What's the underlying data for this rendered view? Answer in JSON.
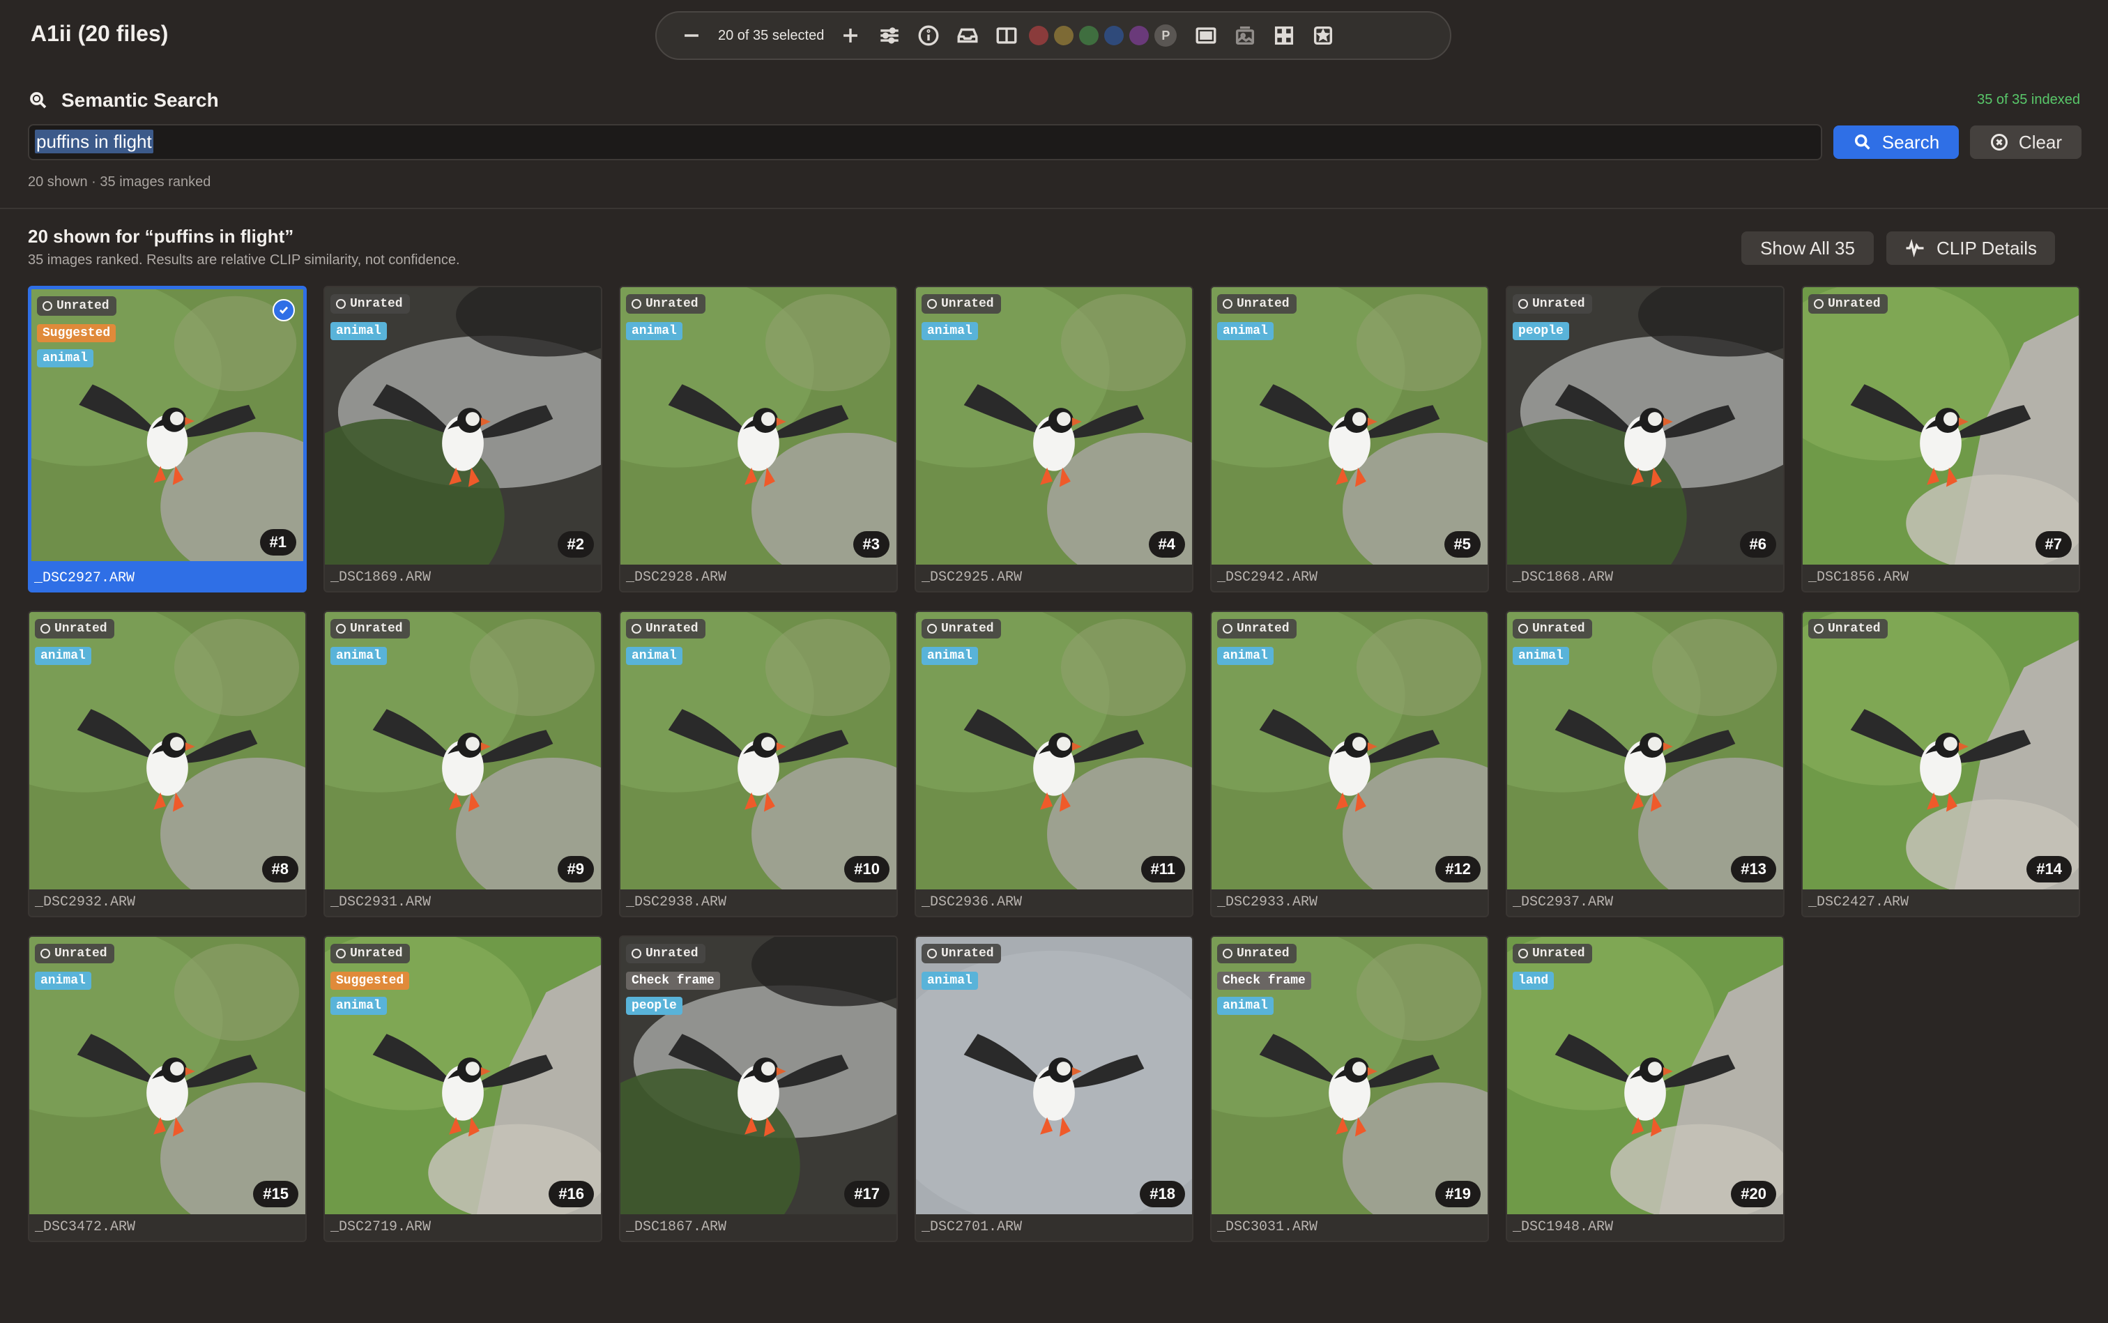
{
  "app": {
    "title": "A1ii (20 files)"
  },
  "toolbar": {
    "selection_count": "20 of 35 selected",
    "color_labels": [
      "#8a3b3b",
      "#7d6a35",
      "#3f6e3f",
      "#2f4a7a",
      "#6a3a7a"
    ],
    "p_label": "P",
    "icons": [
      "minus-icon",
      "plus-icon",
      "sliders-icon",
      "info-icon",
      "tray-icon",
      "split-view-icon",
      "fullscreen-icon",
      "photos-icon",
      "grid-icon",
      "star-icon"
    ]
  },
  "search": {
    "heading": "Semantic Search",
    "indexed": "35 of 35 indexed",
    "query": "puffins in flight",
    "search_label": "Search",
    "clear_label": "Clear",
    "ranked_line": "20 shown · 35 images ranked"
  },
  "results": {
    "title": "20 shown for “puffins in flight”",
    "subtitle": "35 images ranked. Results are relative CLIP similarity, not confidence.",
    "show_all_label": "Show All 35",
    "clip_label": "CLIP Details"
  },
  "items": [
    {
      "file": "_DSC2927.ARW",
      "rank": "#1",
      "rating": "Unrated",
      "tags": [
        "Suggested",
        "animal"
      ],
      "selected": true,
      "scene": "grass"
    },
    {
      "file": "_DSC1869.ARW",
      "rank": "#2",
      "rating": "Unrated",
      "tags": [
        "animal"
      ],
      "selected": false,
      "scene": "water"
    },
    {
      "file": "_DSC2928.ARW",
      "rank": "#3",
      "rating": "Unrated",
      "tags": [
        "animal"
      ],
      "selected": false,
      "scene": "grass"
    },
    {
      "file": "_DSC2925.ARW",
      "rank": "#4",
      "rating": "Unrated",
      "tags": [
        "animal"
      ],
      "selected": false,
      "scene": "grass"
    },
    {
      "file": "_DSC2942.ARW",
      "rank": "#5",
      "rating": "Unrated",
      "tags": [
        "animal"
      ],
      "selected": false,
      "scene": "grass"
    },
    {
      "file": "_DSC1868.ARW",
      "rank": "#6",
      "rating": "Unrated",
      "tags": [
        "people"
      ],
      "selected": false,
      "scene": "water"
    },
    {
      "file": "_DSC1856.ARW",
      "rank": "#7",
      "rating": "Unrated",
      "tags": [],
      "selected": false,
      "scene": "rock"
    },
    {
      "file": "_DSC2932.ARW",
      "rank": "#8",
      "rating": "Unrated",
      "tags": [
        "animal"
      ],
      "selected": false,
      "scene": "grass"
    },
    {
      "file": "_DSC2931.ARW",
      "rank": "#9",
      "rating": "Unrated",
      "tags": [
        "animal"
      ],
      "selected": false,
      "scene": "grass"
    },
    {
      "file": "_DSC2938.ARW",
      "rank": "#10",
      "rating": "Unrated",
      "tags": [
        "animal"
      ],
      "selected": false,
      "scene": "grass"
    },
    {
      "file": "_DSC2936.ARW",
      "rank": "#11",
      "rating": "Unrated",
      "tags": [
        "animal"
      ],
      "selected": false,
      "scene": "grass"
    },
    {
      "file": "_DSC2933.ARW",
      "rank": "#12",
      "rating": "Unrated",
      "tags": [
        "animal"
      ],
      "selected": false,
      "scene": "grass"
    },
    {
      "file": "_DSC2937.ARW",
      "rank": "#13",
      "rating": "Unrated",
      "tags": [
        "animal"
      ],
      "selected": false,
      "scene": "grass"
    },
    {
      "file": "_DSC2427.ARW",
      "rank": "#14",
      "rating": "Unrated",
      "tags": [],
      "selected": false,
      "scene": "rock"
    },
    {
      "file": "_DSC3472.ARW",
      "rank": "#15",
      "rating": "Unrated",
      "tags": [
        "animal"
      ],
      "selected": false,
      "scene": "grass"
    },
    {
      "file": "_DSC2719.ARW",
      "rank": "#16",
      "rating": "Unrated",
      "tags": [
        "Suggested",
        "animal"
      ],
      "selected": false,
      "scene": "rock"
    },
    {
      "file": "_DSC1867.ARW",
      "rank": "#17",
      "rating": "Unrated",
      "tags": [
        "Check frame",
        "people"
      ],
      "selected": false,
      "scene": "water"
    },
    {
      "file": "_DSC2701.ARW",
      "rank": "#18",
      "rating": "Unrated",
      "tags": [
        "animal"
      ],
      "selected": false,
      "scene": "sky"
    },
    {
      "file": "_DSC3031.ARW",
      "rank": "#19",
      "rating": "Unrated",
      "tags": [
        "Check frame",
        "animal"
      ],
      "selected": false,
      "scene": "grass"
    },
    {
      "file": "_DSC1948.ARW",
      "rank": "#20",
      "rating": "Unrated",
      "tags": [
        "land"
      ],
      "selected": false,
      "scene": "rock"
    }
  ]
}
